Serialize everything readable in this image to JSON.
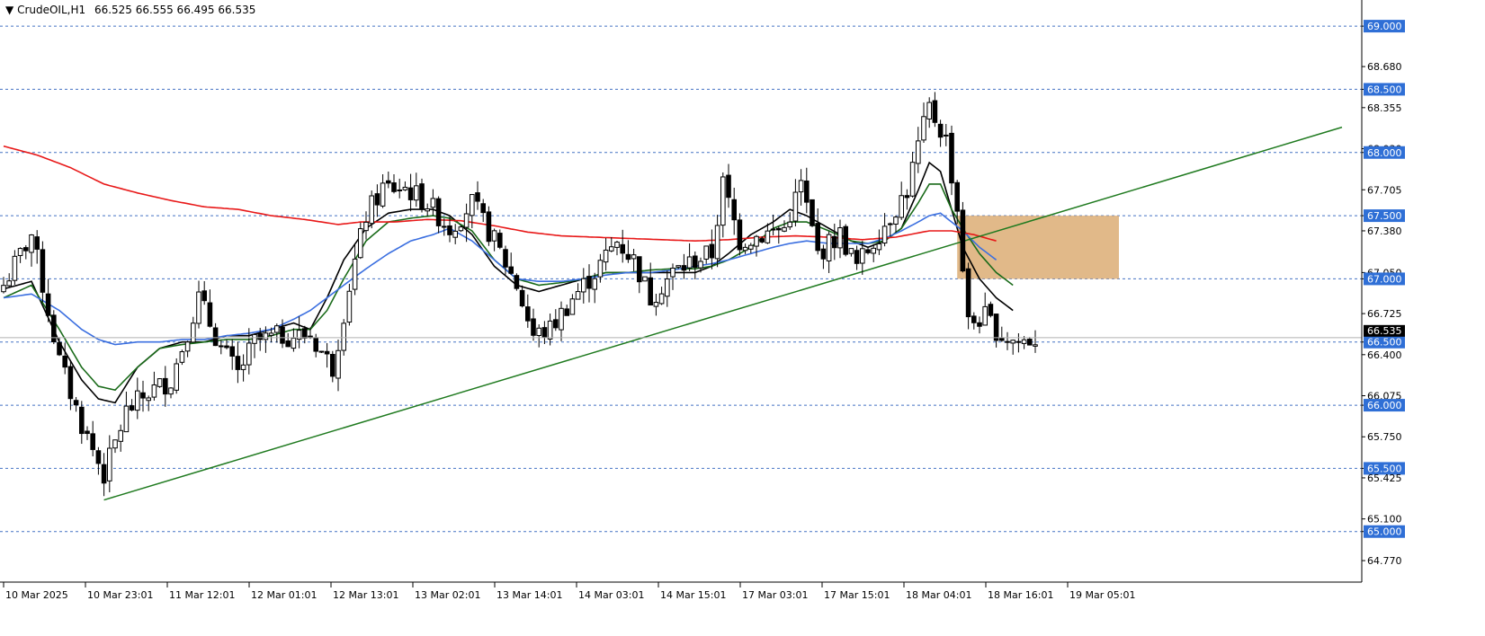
{
  "header": {
    "menu_glyph": "▼",
    "symbol": "CrudeOIL,H1",
    "ohlc": "66.525 66.555 66.495 66.535"
  },
  "colors": {
    "level_line": "#4472c4",
    "level_label_bg": "#2f6fd6",
    "ma_black": "#000000",
    "ma_green": "#1a6b1a",
    "ma_blue": "#3b6fe0",
    "ma_red": "#e81818",
    "trendline": "#1f7a1f",
    "zone_fill": "#d9a86b",
    "bull_candle": "#ffffff",
    "bear_candle": "#000000"
  },
  "chart_data": {
    "type": "candlestick",
    "symbol": "CrudeOIL",
    "timeframe": "H1",
    "ylim": [
      64.6,
      69.15
    ],
    "y_ticks": [
      "69.000",
      "68.680",
      "68.500",
      "68.355",
      "68.030",
      "68.000",
      "67.705",
      "67.500",
      "67.380",
      "67.050",
      "67.000",
      "66.725",
      "66.500",
      "66.400",
      "66.075",
      "66.000",
      "65.750",
      "65.500",
      "65.425",
      "65.100",
      "65.000",
      "64.770"
    ],
    "horizontal_levels": [
      "69.000",
      "68.500",
      "68.000",
      "67.500",
      "67.000",
      "66.500",
      "66.000",
      "65.500",
      "65.000"
    ],
    "current_price": "66.535",
    "x_tick_labels": [
      "10 Mar 2025",
      "10 Mar 23:01",
      "11 Mar 12:01",
      "12 Mar 01:01",
      "12 Mar 13:01",
      "13 Mar 02:01",
      "13 Mar 14:01",
      "14 Mar 03:01",
      "14 Mar 15:01",
      "17 Mar 03:01",
      "17 Mar 15:01",
      "18 Mar 04:01",
      "18 Mar 16:01",
      "19 Mar 05:01"
    ],
    "close_anchors": [
      [
        0,
        66.95
      ],
      [
        5,
        67.35
      ],
      [
        10,
        66.35
      ],
      [
        14,
        65.85
      ],
      [
        18,
        65.45
      ],
      [
        22,
        65.95
      ],
      [
        26,
        66.1
      ],
      [
        30,
        66.2
      ],
      [
        35,
        66.85
      ],
      [
        39,
        66.45
      ],
      [
        42,
        66.25
      ],
      [
        45,
        66.5
      ],
      [
        50,
        66.55
      ],
      [
        55,
        66.55
      ],
      [
        59,
        66.3
      ],
      [
        62,
        66.95
      ],
      [
        65,
        67.5
      ],
      [
        68,
        67.72
      ],
      [
        72,
        67.72
      ],
      [
        76,
        67.6
      ],
      [
        80,
        67.4
      ],
      [
        84,
        67.6
      ],
      [
        88,
        67.3
      ],
      [
        92,
        66.95
      ],
      [
        95,
        66.55
      ],
      [
        98,
        66.6
      ],
      [
        102,
        66.85
      ],
      [
        106,
        67.05
      ],
      [
        110,
        67.3
      ],
      [
        113,
        67.15
      ],
      [
        116,
        66.85
      ],
      [
        120,
        67.05
      ],
      [
        124,
        67.15
      ],
      [
        127,
        67.2
      ],
      [
        129,
        67.75
      ],
      [
        132,
        67.3
      ],
      [
        136,
        67.35
      ],
      [
        140,
        67.4
      ],
      [
        143,
        67.75
      ],
      [
        146,
        67.2
      ],
      [
        150,
        67.35
      ],
      [
        153,
        67.1
      ],
      [
        156,
        67.3
      ],
      [
        159,
        67.5
      ],
      [
        162,
        67.7
      ],
      [
        164,
        68.05
      ],
      [
        166,
        68.35
      ],
      [
        169,
        68.1
      ],
      [
        171,
        67.55
      ],
      [
        173,
        66.65
      ],
      [
        176,
        66.7
      ],
      [
        179,
        66.55
      ],
      [
        182,
        66.5
      ],
      [
        185,
        66.53
      ]
    ],
    "series": [
      {
        "name": "MA black",
        "anchors": [
          [
            0,
            66.92
          ],
          [
            5,
            66.98
          ],
          [
            10,
            66.5
          ],
          [
            14,
            66.2
          ],
          [
            17,
            66.05
          ],
          [
            20,
            66.02
          ],
          [
            24,
            66.3
          ],
          [
            28,
            66.45
          ],
          [
            32,
            66.5
          ],
          [
            36,
            66.5
          ],
          [
            40,
            66.55
          ],
          [
            44,
            66.55
          ],
          [
            48,
            66.6
          ],
          [
            52,
            66.65
          ],
          [
            55,
            66.6
          ],
          [
            58,
            66.85
          ],
          [
            61,
            67.15
          ],
          [
            65,
            67.4
          ],
          [
            69,
            67.52
          ],
          [
            73,
            67.55
          ],
          [
            77,
            67.55
          ],
          [
            80,
            67.5
          ],
          [
            84,
            67.35
          ],
          [
            88,
            67.1
          ],
          [
            92,
            66.95
          ],
          [
            96,
            66.9
          ],
          [
            100,
            66.95
          ],
          [
            104,
            67.0
          ],
          [
            108,
            67.05
          ],
          [
            112,
            67.05
          ],
          [
            116,
            67.05
          ],
          [
            120,
            67.05
          ],
          [
            124,
            67.05
          ],
          [
            127,
            67.1
          ],
          [
            130,
            67.2
          ],
          [
            134,
            67.35
          ],
          [
            138,
            67.45
          ],
          [
            141,
            67.55
          ],
          [
            144,
            67.5
          ],
          [
            148,
            67.4
          ],
          [
            152,
            67.3
          ],
          [
            155,
            67.25
          ],
          [
            158,
            67.3
          ],
          [
            161,
            67.4
          ],
          [
            164,
            67.7
          ],
          [
            166,
            67.92
          ],
          [
            168,
            67.85
          ],
          [
            170,
            67.55
          ],
          [
            172,
            67.25
          ],
          [
            175,
            67.0
          ],
          [
            178,
            66.85
          ],
          [
            181,
            66.75
          ]
        ]
      },
      {
        "name": "MA green",
        "anchors": [
          [
            0,
            66.85
          ],
          [
            5,
            66.95
          ],
          [
            10,
            66.6
          ],
          [
            14,
            66.3
          ],
          [
            17,
            66.15
          ],
          [
            20,
            66.12
          ],
          [
            24,
            66.3
          ],
          [
            28,
            66.45
          ],
          [
            32,
            66.48
          ],
          [
            36,
            66.5
          ],
          [
            40,
            66.52
          ],
          [
            44,
            66.52
          ],
          [
            48,
            66.55
          ],
          [
            52,
            66.6
          ],
          [
            55,
            66.6
          ],
          [
            58,
            66.75
          ],
          [
            61,
            67.0
          ],
          [
            65,
            67.3
          ],
          [
            69,
            67.45
          ],
          [
            73,
            67.48
          ],
          [
            77,
            67.5
          ],
          [
            80,
            67.48
          ],
          [
            84,
            67.38
          ],
          [
            88,
            67.15
          ],
          [
            92,
            67.0
          ],
          [
            96,
            66.95
          ],
          [
            100,
            66.97
          ],
          [
            104,
            67.0
          ],
          [
            108,
            67.05
          ],
          [
            112,
            67.05
          ],
          [
            116,
            67.07
          ],
          [
            120,
            67.08
          ],
          [
            124,
            67.08
          ],
          [
            127,
            67.1
          ],
          [
            130,
            67.15
          ],
          [
            134,
            67.25
          ],
          [
            138,
            67.4
          ],
          [
            141,
            67.45
          ],
          [
            144,
            67.45
          ],
          [
            148,
            67.38
          ],
          [
            152,
            67.3
          ],
          [
            155,
            67.28
          ],
          [
            158,
            67.3
          ],
          [
            161,
            67.4
          ],
          [
            164,
            67.6
          ],
          [
            166,
            67.75
          ],
          [
            168,
            67.75
          ],
          [
            170,
            67.55
          ],
          [
            172,
            67.4
          ],
          [
            175,
            67.2
          ],
          [
            178,
            67.05
          ],
          [
            181,
            66.95
          ]
        ]
      },
      {
        "name": "MA blue",
        "anchors": [
          [
            0,
            66.85
          ],
          [
            5,
            66.88
          ],
          [
            10,
            66.75
          ],
          [
            14,
            66.6
          ],
          [
            17,
            66.52
          ],
          [
            20,
            66.48
          ],
          [
            24,
            66.5
          ],
          [
            28,
            66.5
          ],
          [
            32,
            66.52
          ],
          [
            36,
            66.52
          ],
          [
            40,
            66.55
          ],
          [
            44,
            66.57
          ],
          [
            48,
            66.6
          ],
          [
            52,
            66.68
          ],
          [
            55,
            66.75
          ],
          [
            58,
            66.85
          ],
          [
            61,
            66.95
          ],
          [
            65,
            67.08
          ],
          [
            69,
            67.2
          ],
          [
            73,
            67.3
          ],
          [
            77,
            67.35
          ],
          [
            80,
            67.4
          ],
          [
            84,
            67.3
          ],
          [
            88,
            67.15
          ],
          [
            92,
            67.0
          ],
          [
            96,
            66.98
          ],
          [
            100,
            66.98
          ],
          [
            104,
            67.0
          ],
          [
            108,
            67.03
          ],
          [
            112,
            67.05
          ],
          [
            116,
            67.05
          ],
          [
            120,
            67.07
          ],
          [
            124,
            67.1
          ],
          [
            127,
            67.12
          ],
          [
            130,
            67.15
          ],
          [
            134,
            67.2
          ],
          [
            138,
            67.25
          ],
          [
            141,
            67.28
          ],
          [
            144,
            67.3
          ],
          [
            148,
            67.28
          ],
          [
            152,
            67.28
          ],
          [
            155,
            67.28
          ],
          [
            158,
            67.32
          ],
          [
            161,
            67.38
          ],
          [
            164,
            67.45
          ],
          [
            166,
            67.5
          ],
          [
            168,
            67.52
          ],
          [
            170,
            67.45
          ],
          [
            172,
            67.38
          ],
          [
            175,
            67.25
          ],
          [
            178,
            67.15
          ]
        ]
      },
      {
        "name": "MA red",
        "anchors": [
          [
            0,
            68.05
          ],
          [
            6,
            67.98
          ],
          [
            12,
            67.88
          ],
          [
            18,
            67.75
          ],
          [
            24,
            67.68
          ],
          [
            30,
            67.62
          ],
          [
            36,
            67.57
          ],
          [
            42,
            67.55
          ],
          [
            48,
            67.5
          ],
          [
            54,
            67.47
          ],
          [
            60,
            67.43
          ],
          [
            64,
            67.45
          ],
          [
            70,
            67.45
          ],
          [
            76,
            67.47
          ],
          [
            82,
            67.46
          ],
          [
            88,
            67.42
          ],
          [
            94,
            67.37
          ],
          [
            100,
            67.34
          ],
          [
            106,
            67.33
          ],
          [
            112,
            67.32
          ],
          [
            118,
            67.31
          ],
          [
            124,
            67.3
          ],
          [
            130,
            67.31
          ],
          [
            136,
            67.33
          ],
          [
            142,
            67.34
          ],
          [
            148,
            67.33
          ],
          [
            154,
            67.31
          ],
          [
            160,
            67.33
          ],
          [
            166,
            67.38
          ],
          [
            170,
            67.38
          ],
          [
            174,
            67.35
          ],
          [
            178,
            67.3
          ]
        ]
      }
    ],
    "trendline": {
      "from": [
        18,
        65.25
      ],
      "to": [
        240,
        68.2
      ]
    },
    "zone": {
      "x_from": 171,
      "x_to": 200,
      "y_from": 67.0,
      "y_to": 67.5
    }
  }
}
